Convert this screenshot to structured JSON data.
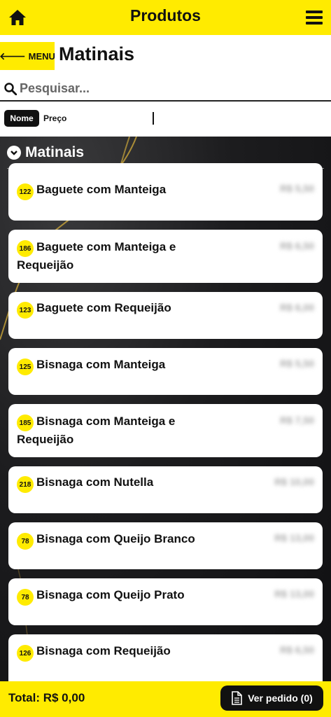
{
  "header": {
    "title": "Produtos",
    "home_icon": "home-icon",
    "menu_icon": "hamburger-icon"
  },
  "nav": {
    "back_arrow": "🡐",
    "menu_label": "MENU",
    "category_title": "Matinais"
  },
  "search": {
    "placeholder": "Pesquisar..."
  },
  "sort": {
    "by_name": "Nome",
    "by_price": "Preço"
  },
  "section": {
    "title": "Matinais"
  },
  "products": [
    {
      "code": "122",
      "name": "Baguete com Manteiga",
      "price": "R$ 5,50"
    },
    {
      "code": "186",
      "name": "Baguete com Manteiga e Requeijão",
      "price": "R$ 6,50"
    },
    {
      "code": "123",
      "name": "Baguete com Requeijão",
      "price": "R$ 6,00"
    },
    {
      "code": "125",
      "name": "Bisnaga com Manteiga",
      "price": "R$ 5,50"
    },
    {
      "code": "185",
      "name": "Bisnaga com Manteiga e Requeijão",
      "price": "R$ 7,50"
    },
    {
      "code": "218",
      "name": "Bisnaga com Nutella",
      "price": "R$ 10,00"
    },
    {
      "code": "78",
      "name": "Bisnaga com Queijo Branco",
      "price": "R$ 13,00"
    },
    {
      "code": "78",
      "name": "Bisnaga com Queijo Prato",
      "price": "R$ 13,00"
    },
    {
      "code": "126",
      "name": "Bisnaga com Requeijão",
      "price": "R$ 6,50"
    }
  ],
  "footer": {
    "total": "Total: R$ 0,00",
    "order_button": "Ver pedido (0)"
  },
  "colors": {
    "accent": "#ffeb00",
    "dark": "#111111"
  }
}
